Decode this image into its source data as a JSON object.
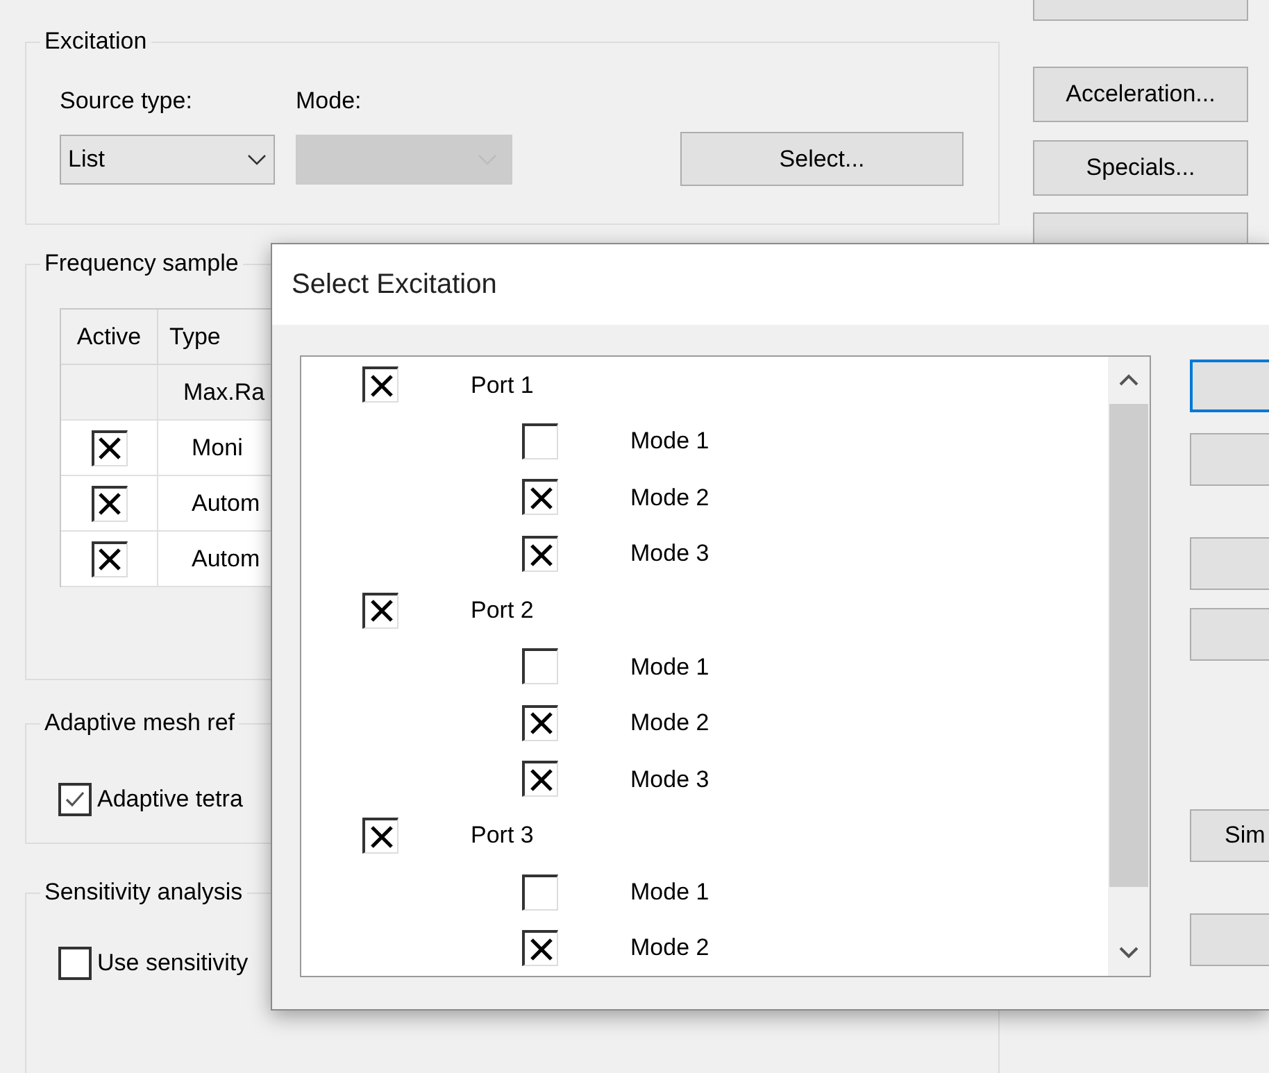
{
  "excitation": {
    "title": "Excitation",
    "source_type_label": "Source type:",
    "source_type": "List",
    "mode_label": "Mode:",
    "mode_disabled": true,
    "select_button": "Select..."
  },
  "frequency_samples": {
    "title": "Frequency sample",
    "columns": [
      "Active",
      "Type"
    ],
    "rows": [
      {
        "kind": "text",
        "type": "Max.Ra"
      },
      {
        "kind": "checkbox",
        "checked": true,
        "type": "Moni"
      },
      {
        "kind": "checkbox",
        "checked": true,
        "type": "Autom"
      },
      {
        "kind": "checkbox",
        "checked": true,
        "type": "Autom"
      }
    ]
  },
  "adaptive_mesh": {
    "title": "Adaptive mesh ref",
    "checkbox": {
      "label": "Adaptive tetra",
      "checked": true
    }
  },
  "sensitivity": {
    "title": "Sensitivity analysis",
    "checkbox": {
      "label": "Use sensitivity",
      "checked": false
    }
  },
  "side_buttons": [
    {
      "kind": "blank"
    },
    {
      "kind": "text",
      "label": "Acceleration..."
    },
    {
      "kind": "text",
      "label": "Specials..."
    },
    {
      "kind": "blank"
    }
  ],
  "dialog": {
    "title": "Select Excitation",
    "tree": [
      {
        "label": "Port 1",
        "checked": true,
        "children": [
          {
            "label": "Mode 1",
            "checked": false
          },
          {
            "label": "Mode 2",
            "checked": true
          },
          {
            "label": "Mode 3",
            "checked": true
          }
        ]
      },
      {
        "label": "Port 2",
        "checked": true,
        "children": [
          {
            "label": "Mode 1",
            "checked": false
          },
          {
            "label": "Mode 2",
            "checked": true
          },
          {
            "label": "Mode 3",
            "checked": true
          }
        ]
      },
      {
        "label": "Port 3",
        "checked": true,
        "children": [
          {
            "label": "Mode 1",
            "checked": false
          },
          {
            "label": "Mode 2",
            "checked": true
          }
        ]
      }
    ],
    "buttons": [
      {
        "kind": "blank",
        "focused": true
      },
      {
        "kind": "blank",
        "focused": false
      },
      {
        "kind": "blank",
        "focused": false
      },
      {
        "kind": "blank",
        "focused": false
      },
      {
        "kind": "text",
        "label": "Sim",
        "focused": false
      },
      {
        "kind": "blank",
        "focused": false
      }
    ]
  }
}
